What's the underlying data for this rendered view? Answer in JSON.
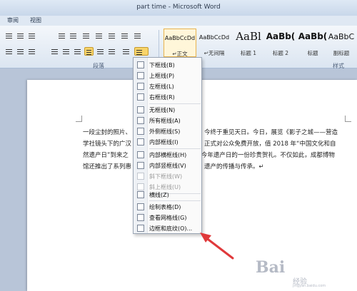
{
  "window": {
    "title": "part time - Microsoft Word"
  },
  "tabs": [
    {
      "label": "审阅"
    },
    {
      "label": "视图"
    }
  ],
  "ribbon": {
    "group_paragraph_label": "段落",
    "group_styles_label": "样式",
    "styles": [
      {
        "sample": "AaBbCcDd",
        "name": "↵正文"
      },
      {
        "sample": "AaBbCcDd",
        "name": "↵无间隔"
      },
      {
        "sample": "AaBl",
        "name": "标题 1"
      },
      {
        "sample": "AaBb(",
        "name": "标题 2"
      },
      {
        "sample": "AaBb(",
        "name": "标题"
      },
      {
        "sample": "AaBbC",
        "name": "副标题"
      }
    ]
  },
  "document": {
    "lines": [
      "一段尘封的照片、",
      "学社镜头下的广汉",
      "然遗产日”到来之",
      "馆还推出了系列惠"
    ],
    "lines_right": [
      "今终于重见天日。今日，展览《影子之城——营造",
      "正式对公众免费开放，值 2018 年“中国文化和自",
      "今年遗产日的一份珍贵贺礼。不仅如此，成都博物",
      "遗产的传播与传承。↵"
    ]
  },
  "menu": {
    "items": [
      {
        "label": "下框线(B)",
        "disabled": false
      },
      {
        "label": "上框线(P)",
        "disabled": false
      },
      {
        "label": "左框线(L)",
        "disabled": false
      },
      {
        "label": "右框线(R)",
        "disabled": false
      },
      {
        "label": "无框线(N)",
        "disabled": false
      },
      {
        "label": "所有框线(A)",
        "disabled": false
      },
      {
        "label": "外侧框线(S)",
        "disabled": false
      },
      {
        "label": "内部框线(I)",
        "disabled": false
      },
      {
        "label": "内部横框线(H)",
        "disabled": false
      },
      {
        "label": "内部竖框线(V)",
        "disabled": false
      },
      {
        "label": "斜下框线(W)",
        "disabled": true
      },
      {
        "label": "斜上框线(U)",
        "disabled": true
      },
      {
        "label": "横线(Z)",
        "disabled": false
      },
      {
        "label": "绘制表格(D)",
        "disabled": false
      },
      {
        "label": "查看网格线(G)",
        "disabled": false
      },
      {
        "label": "边框和底纹(O)...",
        "disabled": false
      }
    ]
  },
  "watermark": {
    "main": "Bai",
    "sub": "经验",
    "url": "jingyan.baidu.com"
  },
  "colors": {
    "arrow": "#e0393b",
    "accent": "#f8d46a"
  }
}
